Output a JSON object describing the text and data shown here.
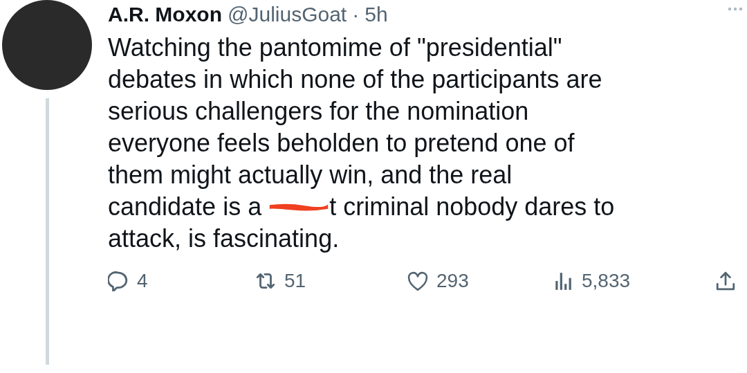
{
  "author": {
    "name": "A.R. Moxon",
    "handle": "@JuliusGoat",
    "separator": "·",
    "time": "5h"
  },
  "body": {
    "lines": [
      [
        {
          "kind": "plain",
          "text": "Watching the pantomime of \"presidential\""
        }
      ],
      [
        {
          "kind": "plain",
          "text": "debates in which none of the participants are"
        }
      ],
      [
        {
          "kind": "plain",
          "text": "serious challengers for the nomination"
        }
      ],
      [
        {
          "kind": "plain",
          "text": "everyone feels beholden to pretend one of"
        }
      ],
      [
        {
          "kind": "plain",
          "text": "them might actually win, and the real"
        }
      ],
      [
        {
          "kind": "plain",
          "text": "candidate is a "
        },
        {
          "kind": "scribble"
        },
        {
          "kind": "plain",
          "text": "t criminal nobody dares to"
        }
      ],
      [
        {
          "kind": "plain",
          "text": "attack, is fascinating."
        }
      ]
    ]
  },
  "actions": [
    {
      "kind": "reply",
      "count": "4"
    },
    {
      "kind": "retweet",
      "count": "51"
    },
    {
      "kind": "like",
      "count": "293"
    },
    {
      "kind": "views",
      "count": "5,833"
    },
    {
      "kind": "share"
    }
  ]
}
